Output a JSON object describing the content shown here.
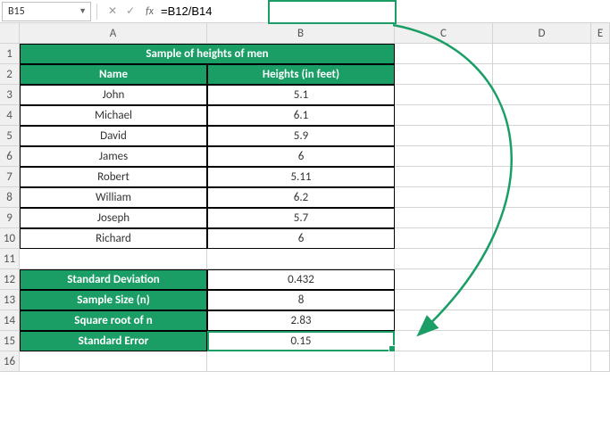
{
  "nameBox": "B15",
  "formula": "=B12/B14",
  "columns": [
    "A",
    "B",
    "C",
    "D",
    "E"
  ],
  "rowCount": 16,
  "title": "Sample of heights of men",
  "headers": {
    "a": "Name",
    "b": "Heights (in feet)"
  },
  "data": [
    {
      "name": "John",
      "height": "5.1"
    },
    {
      "name": "Michael",
      "height": "6.1"
    },
    {
      "name": "David",
      "height": "5.9"
    },
    {
      "name": "James",
      "height": "6"
    },
    {
      "name": "Robert",
      "height": "5.11"
    },
    {
      "name": "William",
      "height": "6.2"
    },
    {
      "name": "Joseph",
      "height": "5.7"
    },
    {
      "name": "Richard",
      "height": "6"
    }
  ],
  "stats": [
    {
      "label": "Standard Deviation",
      "value": "0.432"
    },
    {
      "label": "Sample Size (n)",
      "value": "8"
    },
    {
      "label": "Square root of n",
      "value": "2.83"
    },
    {
      "label": "Standard Error",
      "value": "0.15"
    }
  ]
}
